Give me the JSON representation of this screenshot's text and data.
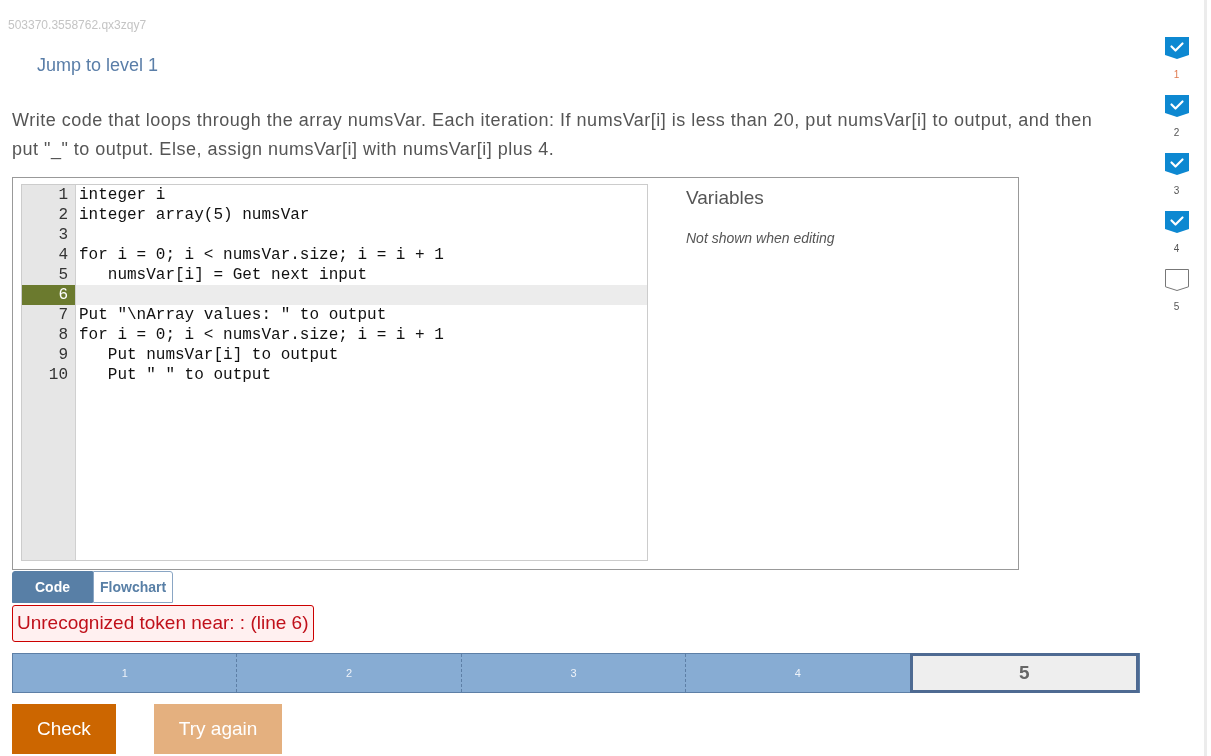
{
  "page_id": "503370.3558762.qx3zqy7",
  "jump_link": "Jump to level 1",
  "instructions": "Write code that loops through the array numsVar. Each iteration: If numsVar[i] is less than 20, put numsVar[i] to output, and then put \"_\" to output. Else, assign numsVar[i] with numsVar[i] plus 4.",
  "editor": {
    "lines": [
      {
        "number": "1",
        "code": "integer i",
        "selected": false
      },
      {
        "number": "2",
        "code": "integer array(5) numsVar",
        "selected": false
      },
      {
        "number": "3",
        "selected": false
      },
      {
        "number": "4",
        "code": "for i = 0; i < numsVar.size; i = i + 1",
        "selected": false
      },
      {
        "number": "5",
        "code": "   numsVar[i] = Get next input",
        "selected": false
      },
      {
        "number": "6",
        "selected": true
      },
      {
        "number": "7",
        "code": "Put \"\\nArray values: \" to output",
        "selected": false
      },
      {
        "number": "8",
        "code": "for i = 0; i < numsVar.size; i = i + 1",
        "selected": false
      },
      {
        "number": "9",
        "code": "   Put numsVar[i] to output",
        "selected": false
      },
      {
        "number": "10",
        "code": "   Put \" \" to output",
        "selected": false
      }
    ]
  },
  "variables": {
    "title": "Variables",
    "note": "Not shown when editing"
  },
  "tabs": [
    {
      "label": "Code",
      "selected": true
    },
    {
      "label": "Flowchart",
      "selected": false
    }
  ],
  "error": "Unrecognized token near: : (line 6)",
  "progress": {
    "segments": [
      {
        "label": "1",
        "completed": true,
        "selected": false
      },
      {
        "label": "2",
        "completed": true,
        "selected": false
      },
      {
        "label": "3",
        "completed": true,
        "selected": false
      },
      {
        "label": "4",
        "completed": true,
        "selected": false
      },
      {
        "label": "5",
        "completed": false,
        "selected": true
      }
    ]
  },
  "buttons": [
    {
      "label": "Check",
      "disabled": false
    },
    {
      "label": "Try again",
      "disabled": true
    }
  ],
  "levels": [
    {
      "label": "1",
      "checked": true,
      "selected": true
    },
    {
      "label": "2",
      "checked": true,
      "selected": false
    },
    {
      "label": "3",
      "checked": true,
      "selected": false
    },
    {
      "label": "4",
      "checked": true,
      "selected": false
    },
    {
      "label": "5",
      "checked": false,
      "selected": false
    }
  ]
}
